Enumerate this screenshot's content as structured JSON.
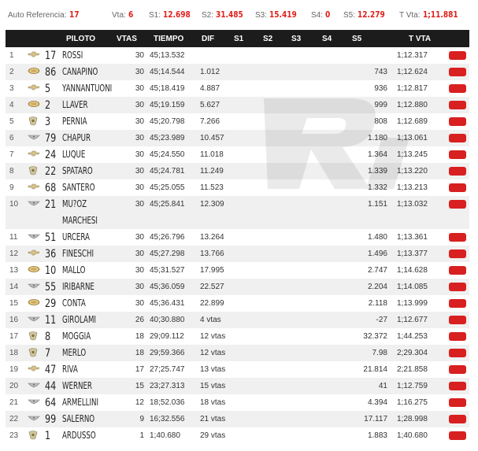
{
  "topbar": {
    "auto_label": "Auto Referencia:",
    "auto_value": "17",
    "vta_label": "Vta:",
    "vta_value": "6",
    "s1_label": "S1:",
    "s1_value": "12.698",
    "s2_label": "S2:",
    "s2_value": "31.485",
    "s3_label": "S3:",
    "s3_value": "15.419",
    "s4_label": "S4:",
    "s4_value": "0",
    "s5_label": "S5:",
    "s5_value": "12.279",
    "tvta_label": "T Vta:",
    "tvta_value": "1;11.881"
  },
  "headers": {
    "piloto": "PILOTO",
    "vtas": "VTAS",
    "tiempo": "TIEMPO",
    "dif": "DIF",
    "s1": "S1",
    "s2": "S2",
    "s3": "S3",
    "s4": "S4",
    "s5": "S5",
    "tvta": "T VTA"
  },
  "colors": {
    "accent_red": "#e0201b",
    "header_bg": "#1c1c1c",
    "row_alt": "#f0f0f0"
  },
  "rows": [
    {
      "pos": "1",
      "brand": "chevrolet",
      "num": "17",
      "name": "ROSSI",
      "vtas": "30",
      "tiempo": "45;13.532",
      "dif": "",
      "s5": "",
      "tvta": "1;12.317"
    },
    {
      "pos": "2",
      "brand": "ford",
      "num": "86",
      "name": "CANAPINO",
      "vtas": "30",
      "tiempo": "45;14.544",
      "dif": "1.012",
      "s5": "743",
      "tvta": "1;12.624"
    },
    {
      "pos": "3",
      "brand": "chevrolet",
      "num": "5",
      "name": "YANNANTUONI",
      "vtas": "30",
      "tiempo": "45;18.419",
      "dif": "4.887",
      "s5": "936",
      "tvta": "1;12.817"
    },
    {
      "pos": "4",
      "brand": "ford",
      "num": "2",
      "name": "LLAVER",
      "vtas": "30",
      "tiempo": "45;19.159",
      "dif": "5.627",
      "s5": "999",
      "tvta": "1;12.880"
    },
    {
      "pos": "5",
      "brand": "dodge",
      "num": "3",
      "name": "PERNIA",
      "vtas": "30",
      "tiempo": "45;20.798",
      "dif": "7.266",
      "s5": "808",
      "tvta": "1;12.689"
    },
    {
      "pos": "6",
      "brand": "torino",
      "num": "79",
      "name": "CHAPUR",
      "vtas": "30",
      "tiempo": "45;23.989",
      "dif": "10.457",
      "s5": "1.180",
      "tvta": "1;13.061"
    },
    {
      "pos": "7",
      "brand": "chevrolet",
      "num": "24",
      "name": "LUQUE",
      "vtas": "30",
      "tiempo": "45;24.550",
      "dif": "11.018",
      "s5": "1.364",
      "tvta": "1;13.245"
    },
    {
      "pos": "8",
      "brand": "dodge",
      "num": "22",
      "name": "SPATARO",
      "vtas": "30",
      "tiempo": "45;24.781",
      "dif": "11.249",
      "s5": "1.339",
      "tvta": "1;13.220"
    },
    {
      "pos": "9",
      "brand": "chevrolet",
      "num": "68",
      "name": "SANTERO",
      "vtas": "30",
      "tiempo": "45;25.055",
      "dif": "11.523",
      "s5": "1.332",
      "tvta": "1;13.213"
    },
    {
      "pos": "10",
      "brand": "torino",
      "num": "21",
      "name": "MU?OZ MARCHESI",
      "vtas": "30",
      "tiempo": "45;25.841",
      "dif": "12.309",
      "s5": "1.151",
      "tvta": "1;13.032"
    },
    {
      "pos": "11",
      "brand": "torino",
      "num": "51",
      "name": "URCERA",
      "vtas": "30",
      "tiempo": "45;26.796",
      "dif": "13.264",
      "s5": "1.480",
      "tvta": "1;13.361"
    },
    {
      "pos": "12",
      "brand": "chevrolet",
      "num": "36",
      "name": "FINESCHI",
      "vtas": "30",
      "tiempo": "45;27.298",
      "dif": "13.766",
      "s5": "1.496",
      "tvta": "1;13.377"
    },
    {
      "pos": "13",
      "brand": "ford",
      "num": "10",
      "name": "MALLO",
      "vtas": "30",
      "tiempo": "45;31.527",
      "dif": "17.995",
      "s5": "2.747",
      "tvta": "1;14.628"
    },
    {
      "pos": "14",
      "brand": "torino",
      "num": "55",
      "name": "IRIBARNE",
      "vtas": "30",
      "tiempo": "45;36.059",
      "dif": "22.527",
      "s5": "2.204",
      "tvta": "1;14.085"
    },
    {
      "pos": "15",
      "brand": "ford",
      "num": "29",
      "name": "CONTA",
      "vtas": "30",
      "tiempo": "45;36.431",
      "dif": "22.899",
      "s5": "2.118",
      "tvta": "1;13.999"
    },
    {
      "pos": "16",
      "brand": "torino",
      "num": "11",
      "name": "GIROLAMI",
      "vtas": "26",
      "tiempo": "40;30.880",
      "dif": "4 vtas",
      "s5": "-27",
      "tvta": "1;12.677"
    },
    {
      "pos": "17",
      "brand": "dodge",
      "num": "8",
      "name": "MOGGIA",
      "vtas": "18",
      "tiempo": "29;09.112",
      "dif": "12 vtas",
      "s5": "32.372",
      "tvta": "1;44.253"
    },
    {
      "pos": "18",
      "brand": "dodge",
      "num": "7",
      "name": "MERLO",
      "vtas": "18",
      "tiempo": "29;59.366",
      "dif": "12 vtas",
      "s5": "7.98",
      "tvta": "2;29.304"
    },
    {
      "pos": "19",
      "brand": "chevrolet",
      "num": "47",
      "name": "RIVA",
      "vtas": "17",
      "tiempo": "27;25.747",
      "dif": "13 vtas",
      "s5": "21.814",
      "tvta": "2;21.858"
    },
    {
      "pos": "20",
      "brand": "torino",
      "num": "44",
      "name": "WERNER",
      "vtas": "15",
      "tiempo": "23;27.313",
      "dif": "15 vtas",
      "s5": "41",
      "tvta": "1;12.759"
    },
    {
      "pos": "21",
      "brand": "torino",
      "num": "64",
      "name": "ARMELLINI",
      "vtas": "12",
      "tiempo": "18;52.036",
      "dif": "18 vtas",
      "s5": "4.394",
      "tvta": "1;16.275"
    },
    {
      "pos": "22",
      "brand": "torino",
      "num": "99",
      "name": "SALERNO",
      "vtas": "9",
      "tiempo": "16;32.556",
      "dif": "21 vtas",
      "s5": "17.117",
      "tvta": "1;28.998"
    },
    {
      "pos": "23",
      "brand": "dodge",
      "num": "1",
      "name": "ARDUSSO",
      "vtas": "1",
      "tiempo": "1;40.680",
      "dif": "29 vtas",
      "s5": "1.883",
      "tvta": "1;40.680"
    }
  ]
}
